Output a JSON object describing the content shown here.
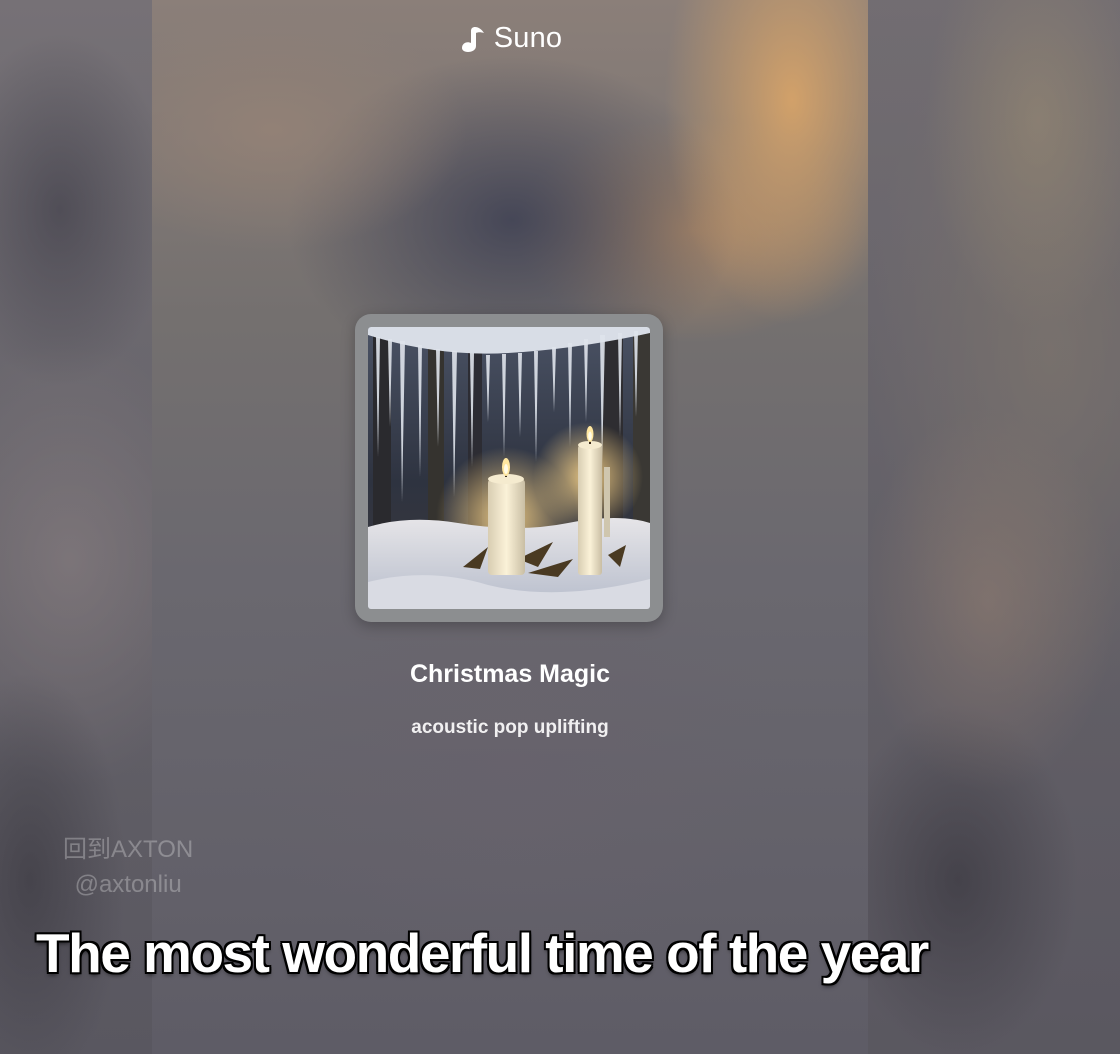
{
  "header": {
    "brand": "Suno",
    "brand_icon": "music-note-icon"
  },
  "song": {
    "title": "Christmas Magic",
    "tags": "acoustic pop uplifting",
    "cover_art": "candles-in-snow-with-icicles-image"
  },
  "watermark": {
    "line1": "回到AXTON",
    "line2": "@axtonliu"
  },
  "caption": {
    "text": "The most wonderful time of the year"
  },
  "colors": {
    "accent_warm": "#d6a369",
    "text_primary": "#ffffff",
    "frame": "#8c8e90"
  }
}
